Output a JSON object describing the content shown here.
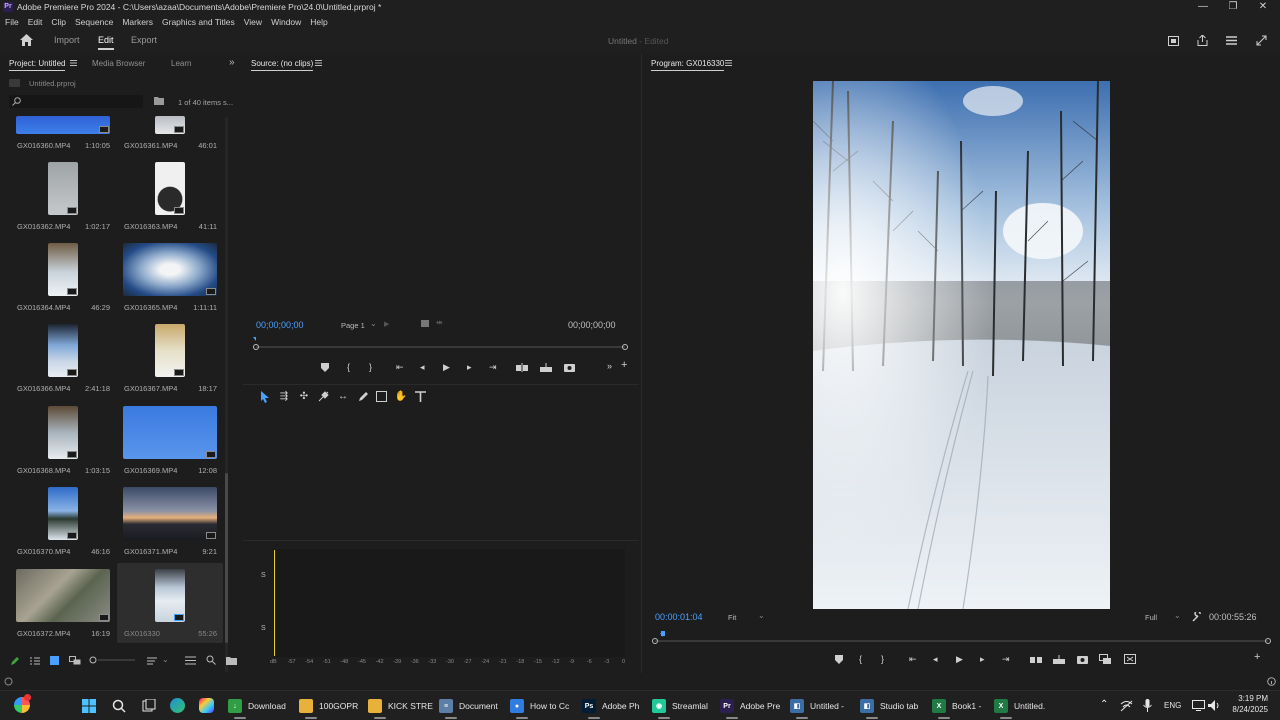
{
  "window": {
    "title": "Adobe Premiere Pro 2024 - C:\\Users\\azaa\\Documents\\Adobe\\Premiere Pro\\24.0\\Untitled.prproj *",
    "controls": {
      "minimize": "—",
      "maximize": "❐",
      "close": "✕"
    }
  },
  "menu": [
    "File",
    "Edit",
    "Clip",
    "Sequence",
    "Markers",
    "Graphics and Titles",
    "View",
    "Window",
    "Help"
  ],
  "header": {
    "tabs": [
      {
        "label": "Import"
      },
      {
        "label": "Edit",
        "active": true
      },
      {
        "label": "Export"
      }
    ],
    "project_title": "Untitled",
    "status": "- Edited"
  },
  "project_panel": {
    "tabs": [
      {
        "label": "Project: Untitled",
        "active": true
      },
      {
        "label": "Media Browser"
      },
      {
        "label": "Learn"
      }
    ],
    "file": "Untitled.prproj",
    "item_count": "1 of 40 items s...",
    "clips": [
      {
        "name": "GX016360.MP4",
        "duration": "1:10:05"
      },
      {
        "name": "GX016361.MP4",
        "duration": "46:01"
      },
      {
        "name": "GX016362.MP4",
        "duration": "1:02:17"
      },
      {
        "name": "GX016363.MP4",
        "duration": "41:11"
      },
      {
        "name": "GX016364.MP4",
        "duration": "46:29"
      },
      {
        "name": "GX016365.MP4",
        "duration": "1:11:11"
      },
      {
        "name": "GX016366.MP4",
        "duration": "2:41:18"
      },
      {
        "name": "GX016367.MP4",
        "duration": "18:17"
      },
      {
        "name": "GX016368.MP4",
        "duration": "1:03:15"
      },
      {
        "name": "GX016369.MP4",
        "duration": "12:08"
      },
      {
        "name": "GX016370.MP4",
        "duration": "46:16"
      },
      {
        "name": "GX016371.MP4",
        "duration": "9:21"
      },
      {
        "name": "GX016372.MP4",
        "duration": "16:19"
      },
      {
        "name": "GX016330",
        "duration": "55:26"
      }
    ]
  },
  "source_monitor": {
    "title": "Source: (no clips)",
    "timecode_in": "00;00;00;00",
    "page": "Page 1",
    "timecode_out": "00;00;00;00"
  },
  "program_monitor": {
    "title": "Program: GX016330",
    "timecode": "00:00:01:04",
    "fit": "Fit",
    "resolution": "Full",
    "duration": "00:00:55:26"
  },
  "audio_meter": {
    "labels": [
      "S",
      "S"
    ],
    "scale": [
      "dB",
      "-57",
      "-54",
      "-51",
      "-48",
      "-45",
      "-42",
      "-39",
      "-36",
      "-33",
      "-30",
      "-27",
      "-24",
      "-21",
      "-18",
      "-15",
      "-12",
      "-9",
      "-6",
      "-3",
      "0"
    ]
  },
  "taskbar": {
    "items": [
      {
        "label": "Download",
        "icon": "download-icon",
        "color": "#2f9e44"
      },
      {
        "label": "100GOPR",
        "icon": "folder-icon",
        "color": "#e8b23a"
      },
      {
        "label": "KICK STRE",
        "icon": "folder-icon",
        "color": "#e8b23a"
      },
      {
        "label": "Document",
        "icon": "notepad-icon",
        "color": "#5b7fa6"
      },
      {
        "label": "How to Cc",
        "icon": "chrome-icon",
        "color": "#2f7de1"
      },
      {
        "label": "Adobe Ph",
        "icon": "photoshop-icon",
        "color": "#001d34"
      },
      {
        "label": "Streamlal",
        "icon": "streamlabs-icon",
        "color": "#20c997"
      },
      {
        "label": "Adobe Pre",
        "icon": "premiere-icon",
        "color": "#2a1f4f"
      },
      {
        "label": "Untitled -",
        "icon": "app-icon",
        "color": "#3a6ea5"
      },
      {
        "label": "Studio tab",
        "icon": "app-icon",
        "color": "#3a6ea5"
      },
      {
        "label": "Book1 -",
        "icon": "excel-icon",
        "color": "#1f7a44"
      },
      {
        "label": "Untitled.",
        "icon": "excel-icon",
        "color": "#1f7a44"
      }
    ],
    "tray": {
      "lang": "ENG",
      "time": "3:19 PM",
      "date": "8/24/2025"
    }
  }
}
